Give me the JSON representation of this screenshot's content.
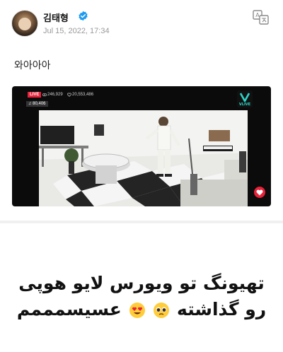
{
  "post": {
    "author": "김태형",
    "date": "Jul 15, 2022, 17:34",
    "text": "와아아아",
    "translate_icon": "translate-icon",
    "verified_icon": "verified-badge-icon"
  },
  "video": {
    "live_label": "LIVE",
    "viewers": "246,929",
    "likes": "20,553,486",
    "listeners": "80,406",
    "logo": "vlive-logo",
    "heart_icon": "heart-icon"
  },
  "caption": {
    "line1": "تهیونگ تو ویورس لایو هوپی",
    "line2_prefix": "رو گذاشته",
    "line2_suffix": "عسیسمممم",
    "emojis": [
      "pleading-face-icon",
      "heart-eyes-face-icon"
    ]
  },
  "colors": {
    "verified_blue": "#1d9bf0",
    "live_red": "#e8213a",
    "vlive_teal": "#2fd3c7"
  }
}
